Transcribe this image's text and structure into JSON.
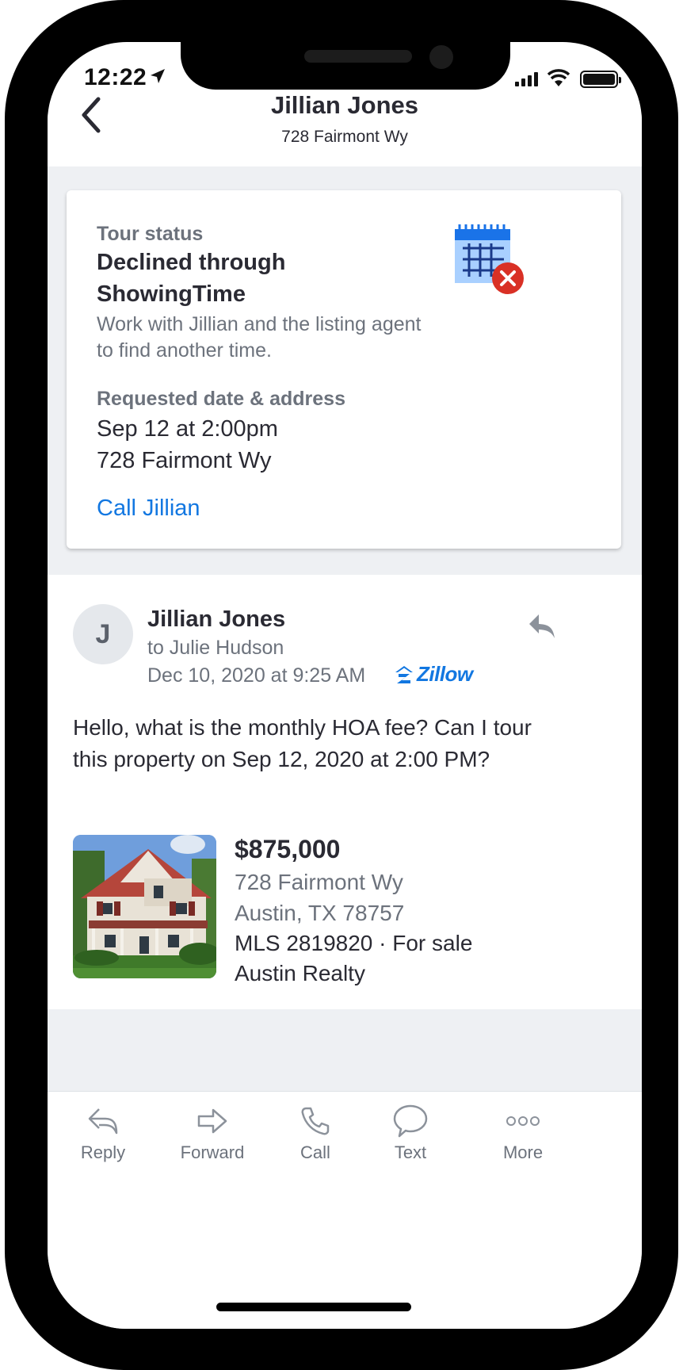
{
  "status_bar": {
    "time": "12:22"
  },
  "header": {
    "title": "Jillian Jones",
    "subtitle": "728 Fairmont Wy"
  },
  "tour_card": {
    "status_label": "Tour status",
    "status_value": "Declined through ShowingTime",
    "description": "Work with Jillian and the listing agent to find another time.",
    "request_label": "Requested date & address",
    "request_date": "Sep 12 at 2:00pm",
    "request_address": "728 Fairmont Wy",
    "call_link": "Call Jillian",
    "icon": "calendar-declined-icon"
  },
  "message": {
    "avatar_initial": "J",
    "sender": "Jillian Jones",
    "recipient": "to Julie Hudson",
    "date": "Dec 10, 2020 at 9:25 AM",
    "source": "Zillow",
    "body": "Hello, what is the monthly HOA fee? Can I tour this property on Sep 12, 2020 at 2:00 PM?"
  },
  "listing": {
    "price": "$875,000",
    "address_line1": "728 Fairmont Wy",
    "address_line2": "Austin, TX 78757",
    "mls": "MLS 2819820 · For sale",
    "broker": "Austin Realty"
  },
  "toolbar": {
    "items": [
      {
        "label": "Reply",
        "icon": "reply-icon"
      },
      {
        "label": "Forward",
        "icon": "forward-icon"
      },
      {
        "label": "Call",
        "icon": "phone-icon"
      },
      {
        "label": "Text",
        "icon": "chat-bubble-icon"
      },
      {
        "label": "More",
        "icon": "more-dots-icon"
      }
    ]
  },
  "colors": {
    "accent": "#1277e1",
    "text": "#2a2a33",
    "muted": "#6c727c",
    "background": "#eef0f3",
    "error": "#d93025"
  }
}
